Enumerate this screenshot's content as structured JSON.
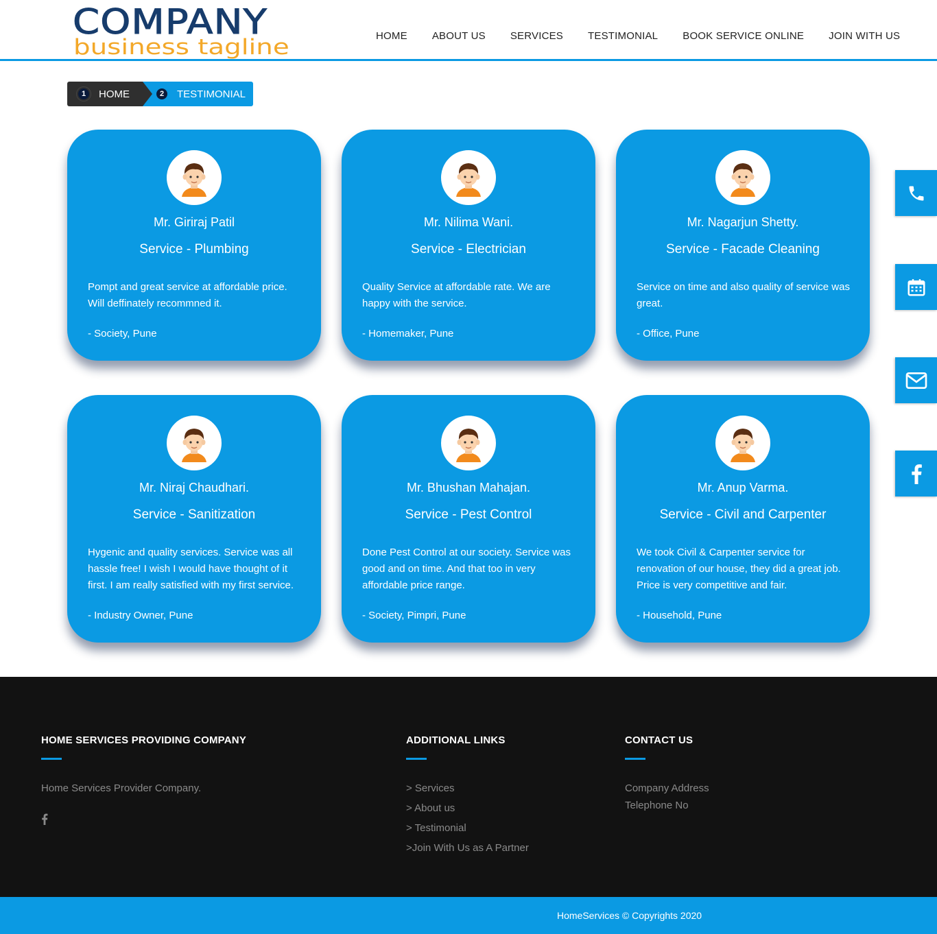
{
  "header": {
    "logo_line1": "COMPANY",
    "logo_line2": "business tagline",
    "nav": [
      "HOME",
      "ABOUT US",
      "SERVICES",
      "TESTIMONIAL",
      "BOOK SERVICE ONLINE",
      "JOIN WITH US"
    ]
  },
  "breadcrumb": {
    "home_num": "1",
    "home_label": "HOME",
    "current_num": "2",
    "current_label": "TESTIMONIAL"
  },
  "testimonials": [
    {
      "name": "Mr. Giriraj Patil",
      "service": "Service - Plumbing",
      "review": "Pompt and great service at affordable price. Will deffinately recommned it.",
      "who": "- Society, Pune"
    },
    {
      "name": "Mr. Nilima Wani.",
      "service": "Service - Electrician",
      "review": "Quality Service at affordable rate. We are happy with the service.",
      "who": "- Homemaker, Pune"
    },
    {
      "name": "Mr. Nagarjun Shetty.",
      "service": "Service - Facade Cleaning",
      "review": "Service on time and also quality of service was great.",
      "who": "- Office, Pune"
    },
    {
      "name": "Mr. Niraj Chaudhari.",
      "service": "Service - Sanitization",
      "review": "Hygenic and quality services. Service was all hassle free! I wish I would have thought of it first. I am really satisfied with my first service.",
      "who": "- Industry Owner, Pune"
    },
    {
      "name": "Mr. Bhushan Mahajan.",
      "service": "Service - Pest Control",
      "review": "Done Pest Control at our society. Service was good and on time. And that too in very affordable price range.",
      "who": "- Society, Pimpri, Pune"
    },
    {
      "name": "Mr. Anup Varma.",
      "service": "Service - Civil and Carpenter",
      "review": "We took Civil & Carpenter service for renovation of our house, they did a great job. Price is very competitive and fair.",
      "who": "- Household, Pune"
    }
  ],
  "side_tabs": [
    "phone-icon",
    "calendar-icon",
    "mail-icon",
    "facebook-icon"
  ],
  "footer": {
    "col1_title": "HOME SERVICES PROVIDING COMPANY",
    "col1_text": "Home Services Provider Company.",
    "col2_title": "ADDITIONAL LINKS",
    "links": [
      "> Services",
      "> About us",
      "> Testimonial",
      ">Join With Us as A Partner"
    ],
    "col3_title": "CONTACT US",
    "address": "Company Address",
    "telephone": "Telephone No",
    "copyright": "HomeServices © Copyrights 2020"
  },
  "colors": {
    "accent": "#0b9ae3",
    "footer_bg": "#121212",
    "logo_blue": "#173c6c",
    "logo_orange": "#f3a829"
  }
}
